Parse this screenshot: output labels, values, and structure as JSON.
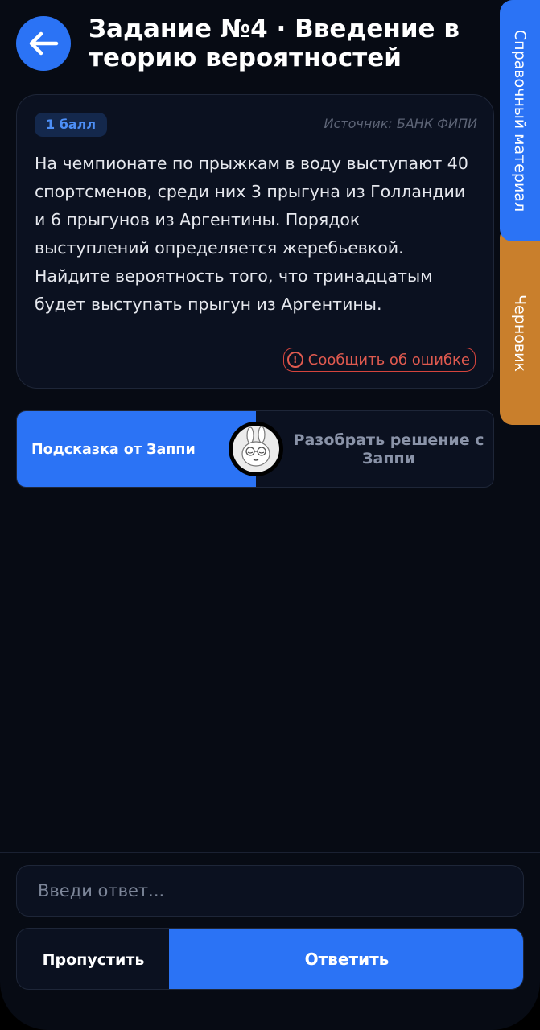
{
  "header": {
    "title": "Задание №4 · Введение в теорию вероятностей",
    "back_icon": "arrow-left-icon"
  },
  "side_tabs": {
    "reference": "Справочный материал",
    "draft": "Черновик"
  },
  "task": {
    "points": "1 балл",
    "source": "Источник: БАНК ФИПИ",
    "text": "На чемпионате по прыжкам в воду выступают 40 спортсменов, среди них 3 прыгуна из Голландии и 6 прыгунов из Аргентины. Порядок выступлений определяется жеребьевкой. Найдите вероятность того, что тринадцатым будет выступать прыгун из Аргентины.",
    "report": "Сообщить об ошибке"
  },
  "hint": {
    "left": "Подсказка от Заппи",
    "right": "Разобрать решение с Заппи",
    "avatar_icon": "zappi-bunny-icon"
  },
  "answer": {
    "placeholder": "Введи ответ..."
  },
  "actions": {
    "skip": "Пропустить",
    "submit": "Ответить"
  },
  "colors": {
    "background": "#070b14",
    "accent": "#2b73f5",
    "draft_tab": "#c97f2c",
    "error": "#e05a4f"
  }
}
